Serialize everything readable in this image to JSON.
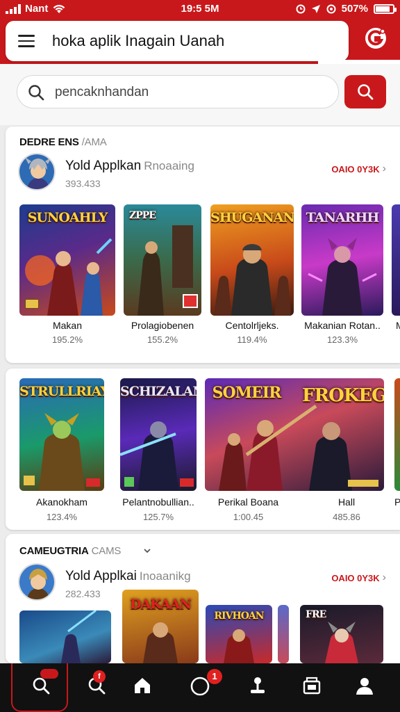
{
  "status_bar": {
    "carrier": "Nant",
    "time": "19:5 5M",
    "battery": "507%",
    "battery_level": 0.85
  },
  "header": {
    "menu_icon": "hamburger-menu-icon",
    "title": "hoka aplik Inagain Uanah",
    "brand_icon": "app-logo-icon",
    "brand_color": "#c9181b"
  },
  "search": {
    "value": "pencaknhandan",
    "icon": "search-icon",
    "button_icon": "search-icon"
  },
  "section1": {
    "title": "DEDRE ENS",
    "subtitle": "/AMA",
    "developer": {
      "name": "Yold Applkan",
      "name_suffix": "Rnoaaing",
      "count": "393.433",
      "link_label": "OAIO 0Y3K"
    },
    "apps": [
      {
        "art_title": "SUNOAHLY",
        "name": "Makan",
        "rating": "195.2%"
      },
      {
        "art_title": "ZPPE",
        "name": "Prolagiobenen",
        "rating": "155.2%"
      },
      {
        "art_title": "SHUGANAN",
        "name": "Centolrljeks.",
        "rating": "119.4%"
      },
      {
        "art_title": "TANARHH",
        "name": "Makanian Rotan..",
        "rating": "123.3%"
      },
      {
        "art_title": "",
        "name": "M",
        "rating": ""
      }
    ]
  },
  "section2": {
    "apps": [
      {
        "art_title": "STRULLRIAY",
        "name": "Akanokham",
        "rating": "123.4%"
      },
      {
        "art_title": "SCHIZALAN",
        "name": "Pelantnobullian..",
        "rating": "125.7%"
      },
      {
        "art_title": "SOMEIR",
        "name": "Perikal Boana",
        "rating": "1:00.45"
      },
      {
        "art_title": "FROKEG",
        "name": "Hall",
        "rating": "485.86"
      },
      {
        "art_title": "",
        "name": "P",
        "rating": ""
      }
    ]
  },
  "section3": {
    "title": "CAMEUGTRIA",
    "subtitle": "CAMS",
    "developer": {
      "name": "Yold Applkai",
      "name_suffix": "Inoaanikg",
      "count": "282.433",
      "link_label": "OAIO 0Y3K"
    },
    "apps": [
      {
        "art_title": "",
        "name": "",
        "rating": ""
      },
      {
        "art_title": "DAKAAN",
        "name": "",
        "rating": ""
      },
      {
        "art_title": "RIVHOAN",
        "name": "",
        "rating": ""
      },
      {
        "art_title": "FRE",
        "name": "",
        "rating": ""
      }
    ]
  },
  "bottom_nav": {
    "items": [
      {
        "icon": "search-icon",
        "active": true
      },
      {
        "icon": "search-icon",
        "badge": "f"
      },
      {
        "icon": "home-icon"
      },
      {
        "icon": "circle-icon",
        "badge": "1"
      },
      {
        "icon": "joystick-icon"
      },
      {
        "icon": "library-icon"
      },
      {
        "icon": "profile-icon"
      }
    ]
  }
}
